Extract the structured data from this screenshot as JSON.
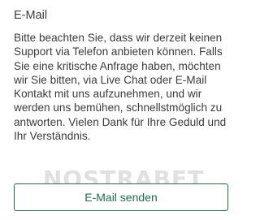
{
  "panel": {
    "title": "E-Mail",
    "message": "Bitte beachten Sie, dass wir derzeit keinen Support via Telefon anbieten können. Falls Sie eine kritische Anfrage haben, möchten wir Sie bitten, via Live Chat oder E-Mail Kontakt mit uns aufzunehmen, und wir werden uns bemühen, schnellstmöglich zu antworten. Vielen Dank für Ihre Geduld und Ihr Verständnis.",
    "button_label": "E-Mail senden"
  },
  "watermark": {
    "text": "NOSTRABET"
  },
  "colors": {
    "accent": "#1f6f47",
    "text": "#3b3b3b",
    "background": "#ffffff",
    "watermark": "#c8c8c8"
  }
}
